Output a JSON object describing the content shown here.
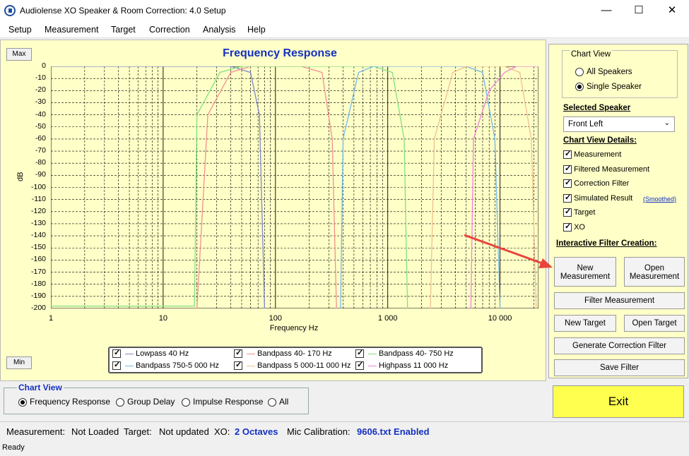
{
  "window": {
    "title": "Audiolense XO Speaker & Room Correction: 4.0 Setup",
    "minimize": "—",
    "maximize": "☐",
    "close": "✕"
  },
  "menu": [
    "Setup",
    "Measurement",
    "Target",
    "Correction",
    "Analysis",
    "Help"
  ],
  "chart": {
    "max_label": "Max",
    "min_label": "Min",
    "chart_data": {
      "type": "line",
      "title": "Frequency Response",
      "xlabel": "Frequency Hz",
      "ylabel": "dB",
      "xscale": "log",
      "xlim": [
        1,
        22000
      ],
      "ylim": [
        -200,
        0
      ],
      "y_ticks": [
        "0",
        "-10",
        "-20",
        "-30",
        "-40",
        "-50",
        "-60",
        "-70",
        "-80",
        "-90",
        "-100",
        "-110",
        "-120",
        "-130",
        "-140",
        "-150",
        "-160",
        "-170",
        "-180",
        "-190",
        "-200"
      ],
      "x_ticks": [
        "1",
        "10",
        "100",
        "1 000",
        "10 000"
      ],
      "grid": true,
      "series": [
        {
          "name": "Lowpass  40 Hz",
          "color": "#7d86cc",
          "points": [
            [
              1,
              0
            ],
            [
              40,
              0
            ],
            [
              60,
              -5
            ],
            [
              72,
              -40
            ],
            [
              80,
              -200
            ]
          ]
        },
        {
          "name": "Bandpass  40- 170 Hz",
          "color": "#f09090",
          "points": [
            [
              20,
              -200
            ],
            [
              25,
              -40
            ],
            [
              40,
              -5
            ],
            [
              60,
              0
            ],
            [
              170,
              0
            ],
            [
              260,
              -5
            ],
            [
              320,
              -60
            ],
            [
              350,
              -200
            ]
          ]
        },
        {
          "name": "Bandpass  40- 750 Hz",
          "color": "#80e080",
          "points": [
            [
              1,
              -198
            ],
            [
              19,
              -198
            ],
            [
              20,
              -40
            ],
            [
              32,
              -5
            ],
            [
              50,
              0
            ],
            [
              750,
              0
            ],
            [
              1100,
              -5
            ],
            [
              1400,
              -60
            ],
            [
              1500,
              -200
            ]
          ]
        },
        {
          "name": "Bandpass  750-5 000 Hz",
          "color": "#70b8e8",
          "points": [
            [
              380,
              -200
            ],
            [
              400,
              -60
            ],
            [
              550,
              -5
            ],
            [
              750,
              0
            ],
            [
              5000,
              0
            ],
            [
              7000,
              -5
            ],
            [
              9000,
              -60
            ],
            [
              10000,
              -200
            ]
          ]
        },
        {
          "name": "Bandpass  5 000-11 000 Hz",
          "color": "#f0c090",
          "points": [
            [
              2400,
              -200
            ],
            [
              2600,
              -60
            ],
            [
              3800,
              -5
            ],
            [
              5000,
              0
            ],
            [
              11000,
              0
            ],
            [
              15000,
              -5
            ],
            [
              19000,
              -60
            ],
            [
              21000,
              -200
            ]
          ]
        },
        {
          "name": "Highpass  11 000 Hz",
          "color": "#f080e0",
          "points": [
            [
              5500,
              -200
            ],
            [
              5800,
              -60
            ],
            [
              8000,
              -20
            ],
            [
              11000,
              -5
            ],
            [
              14000,
              0
            ],
            [
              22000,
              0
            ]
          ]
        }
      ]
    },
    "legend_checked": [
      true,
      true,
      true,
      true,
      true,
      true
    ]
  },
  "panel": {
    "chart_view_title": "Chart View",
    "all_speakers": "All Speakers",
    "single_speaker": "Single Speaker",
    "selected_speaker_heading": "Selected Speaker",
    "speaker_value": "Front Left",
    "details_heading": "Chart View Details:",
    "details": [
      {
        "label": "Measurement",
        "checked": true
      },
      {
        "label": "Filtered Measurement",
        "checked": true
      },
      {
        "label": "Correction Filter",
        "checked": true
      },
      {
        "label": "Simulated Result",
        "checked": true
      },
      {
        "label": "Target",
        "checked": true
      },
      {
        "label": "XO",
        "checked": true
      }
    ],
    "smoothed": "(Smoothed)",
    "interactive_heading": "Interactive Filter Creation:",
    "btn_new_measurement_1": "New",
    "btn_new_measurement_2": "Measurement",
    "btn_open_measurement_1": "Open",
    "btn_open_measurement_2": "Measurement",
    "btn_filter_measurement": "Filter Measurement",
    "btn_new_target": "New Target",
    "btn_open_target": "Open Target",
    "btn_generate": "Generate Correction Filter",
    "btn_save": "Save Filter"
  },
  "exit_label": "Exit",
  "chart_view_bottom": {
    "title": "Chart View",
    "options": [
      "Frequency Response",
      "Group Delay",
      "Impulse Response",
      "All"
    ],
    "selected": "Frequency Response"
  },
  "status": {
    "measurement_label": "Measurement:",
    "measurement_value": "Not Loaded",
    "target_label": "Target:",
    "target_value": "Not updated",
    "xo_label": "XO:",
    "xo_value": "2 Octaves",
    "mic_label": "Mic Calibration:",
    "mic_value": "9606.txt Enabled",
    "ready": "Ready"
  }
}
